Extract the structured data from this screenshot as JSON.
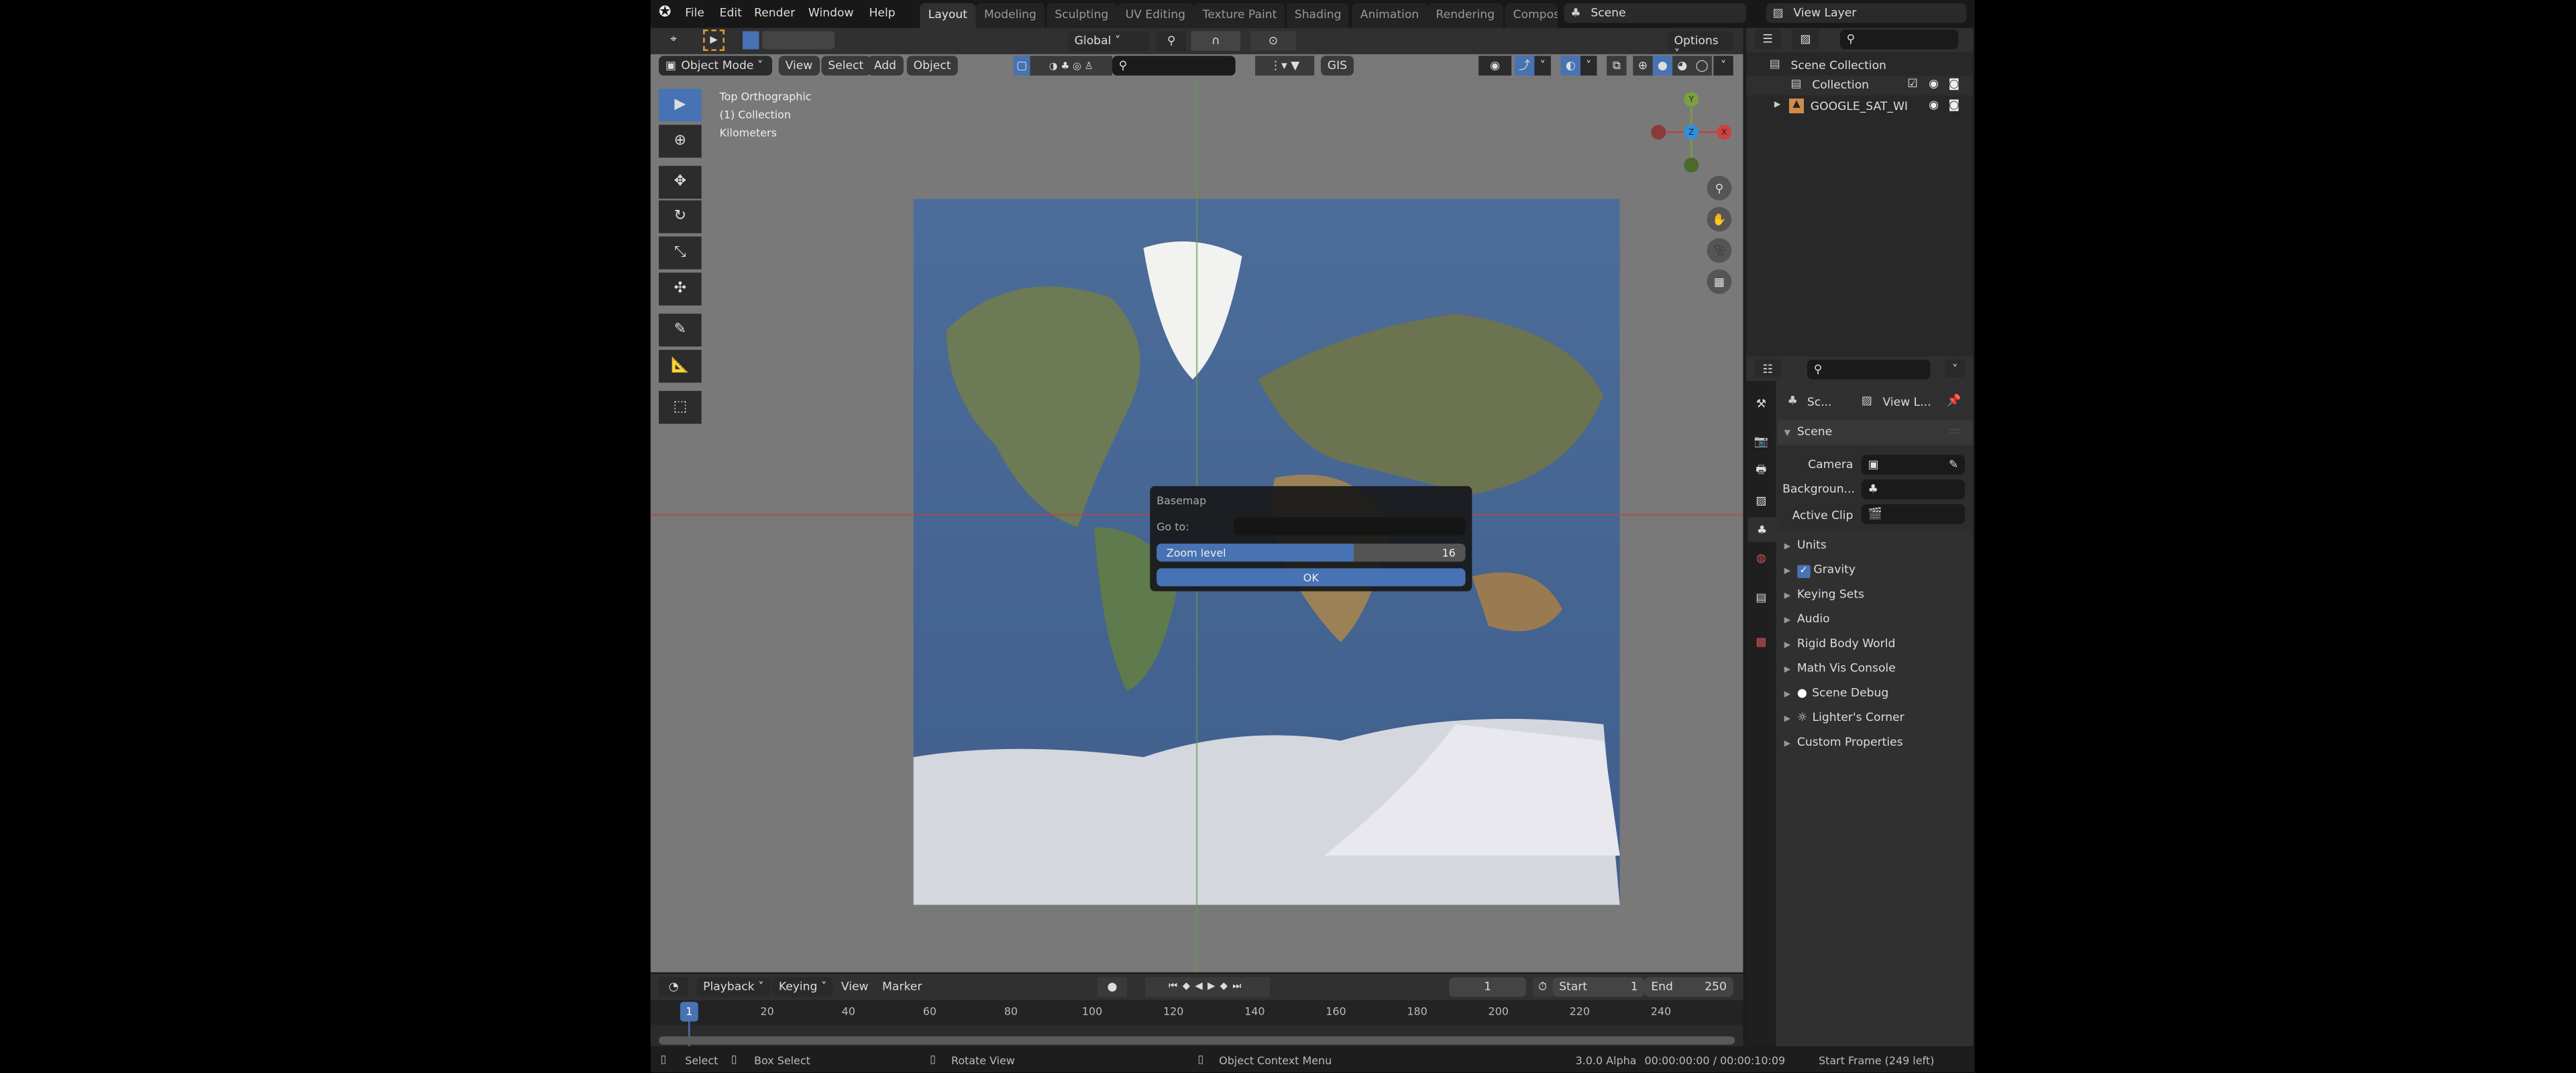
{
  "topbar": {
    "menus": [
      "File",
      "Edit",
      "Render",
      "Window",
      "Help"
    ],
    "workspaces": [
      "Layout",
      "Modeling",
      "Sculpting",
      "UV Editing",
      "Texture Paint",
      "Shading",
      "Animation",
      "Rendering",
      "Compos"
    ],
    "active_workspace": "Layout",
    "scene": "Scene",
    "view_layer": "View Layer"
  },
  "tool_header": {
    "orientation": "Global",
    "options": "Options"
  },
  "viewport_header": {
    "mode": "Object Mode",
    "menus": [
      "View",
      "Select",
      "Add",
      "Object"
    ],
    "gis": "GIS"
  },
  "viewport": {
    "overlay": [
      "Top Orthographic",
      "(1) Collection",
      "Kilometers"
    ],
    "gizmo": {
      "y": "Y",
      "z": "Z",
      "x": "X"
    }
  },
  "dialog": {
    "title": "Basemap",
    "goto_label": "Go to:",
    "goto_value": "",
    "zoom_label": "Zoom level",
    "zoom_value": "16",
    "zoom_fill_percent": 64,
    "ok": "OK"
  },
  "outliner": {
    "root": "Scene Collection",
    "items": [
      {
        "label": "Collection"
      },
      {
        "label": "GOOGLE_SAT_WI"
      }
    ]
  },
  "properties": {
    "breadcrumb": [
      "Sc...",
      "View L..."
    ],
    "panel": "Scene",
    "fields": [
      {
        "label": "Camera"
      },
      {
        "label": "Backgroun..."
      },
      {
        "label": "Active Clip"
      }
    ],
    "sections": [
      "Units",
      "Gravity",
      "Keying Sets",
      "Audio",
      "Rigid Body World",
      "Math Vis Console",
      "Scene Debug",
      "Lighter's Corner",
      "Custom Properties"
    ]
  },
  "timeline": {
    "menus": [
      "Playback",
      "Keying",
      "View",
      "Marker"
    ],
    "current_frame": "1",
    "start_label": "Start",
    "start": "1",
    "end_label": "End",
    "end": "250",
    "ticks": [
      "1",
      "20",
      "40",
      "60",
      "80",
      "100",
      "120",
      "140",
      "160",
      "180",
      "200",
      "220",
      "240"
    ]
  },
  "statusbar": {
    "select": "Select",
    "box_select": "Box Select",
    "rotate": "Rotate View",
    "context": "Object Context Menu",
    "version": "3.0.0 Alpha",
    "time": "00:00:00:00 / 00:00:10:09",
    "info": "Start Frame (249 left)"
  },
  "colors": {
    "accent": "#4772b3",
    "viewport_bg": "#797979",
    "panel_bg": "#303030"
  }
}
